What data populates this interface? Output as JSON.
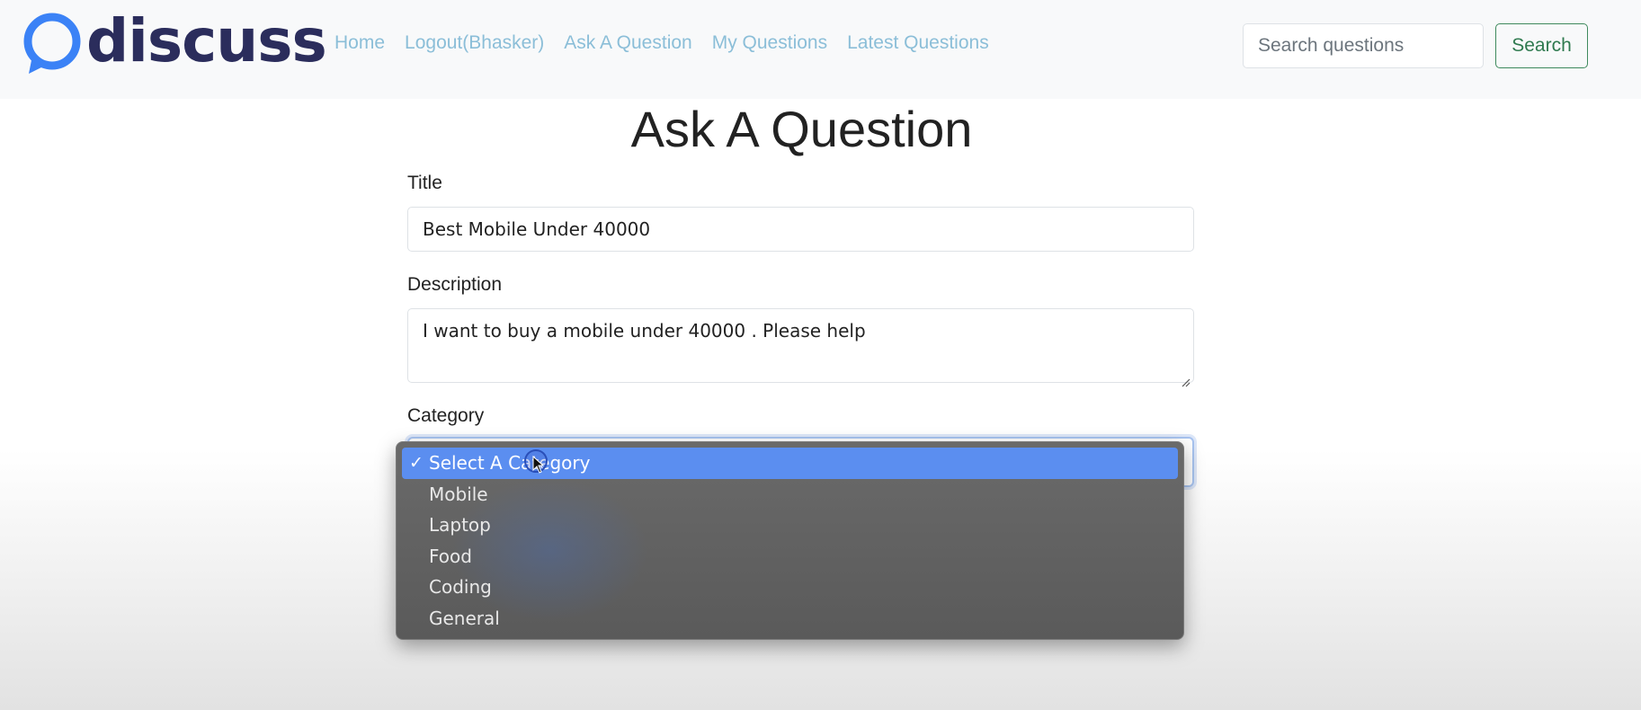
{
  "brand": {
    "name": "discuss",
    "logo_icon": "speech-bubble-icon",
    "logo_color": "#3b82f6"
  },
  "nav": {
    "links": [
      {
        "label": "Home"
      },
      {
        "label": "Logout(Bhasker)"
      },
      {
        "label": "Ask A Question"
      },
      {
        "label": "My Questions"
      },
      {
        "label": "Latest Questions"
      }
    ],
    "link_color": "#8bbed8"
  },
  "search": {
    "placeholder": "Search questions",
    "button_label": "Search"
  },
  "form": {
    "heading": "Ask A Question",
    "title_label": "Title",
    "title_value": "Best Mobile Under 40000",
    "description_label": "Description",
    "description_value": "I want to buy a mobile under 40000 . Please help",
    "category_label": "Category",
    "category_options": [
      {
        "label": "Select A Category",
        "selected": true
      },
      {
        "label": "Mobile",
        "selected": false
      },
      {
        "label": "Laptop",
        "selected": false
      },
      {
        "label": "Food",
        "selected": false
      },
      {
        "label": "Coding",
        "selected": false
      },
      {
        "label": "General",
        "selected": false
      }
    ],
    "selected_check_icon": "checkmark-icon",
    "highlight_color": "#5b8ef0"
  }
}
